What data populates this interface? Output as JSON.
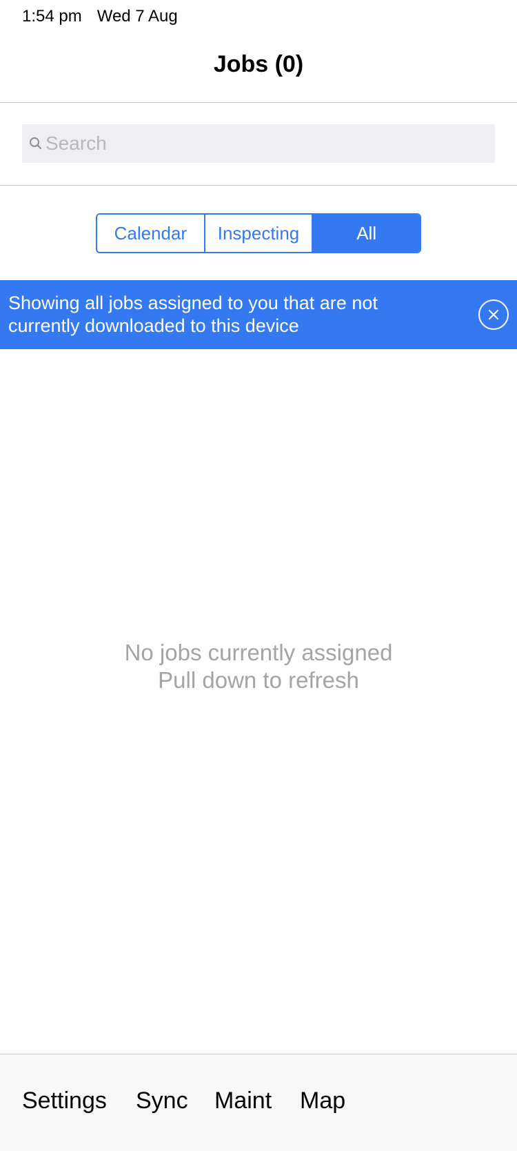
{
  "status_bar": {
    "time": "1:54 pm",
    "date": "Wed 7 Aug"
  },
  "nav": {
    "title": "Jobs (0)"
  },
  "search": {
    "placeholder": "Search",
    "value": "",
    "icon": "search-icon"
  },
  "segments": {
    "items": [
      {
        "label": "Calendar",
        "selected": false
      },
      {
        "label": "Inspecting",
        "selected": false
      },
      {
        "label": "All",
        "selected": true
      }
    ]
  },
  "banner": {
    "line1": "Showing all jobs assigned to you that are not",
    "line2": "currently downloaded to this device",
    "close_icon": "close-circle-icon"
  },
  "empty_state": {
    "line1": "No jobs currently assigned",
    "line2": "Pull down to refresh"
  },
  "tab_bar": {
    "items": [
      {
        "label": "Settings"
      },
      {
        "label": "Sync"
      },
      {
        "label": "Maint"
      },
      {
        "label": "Map"
      }
    ]
  },
  "colors": {
    "accent": "#3478f2",
    "search_bg": "#eeeef3",
    "placeholder": "#b7b7bc",
    "empty_text": "#a3a3a8",
    "tab_bar_bg": "#f8f8f8",
    "separator": "#c8c7cc"
  }
}
